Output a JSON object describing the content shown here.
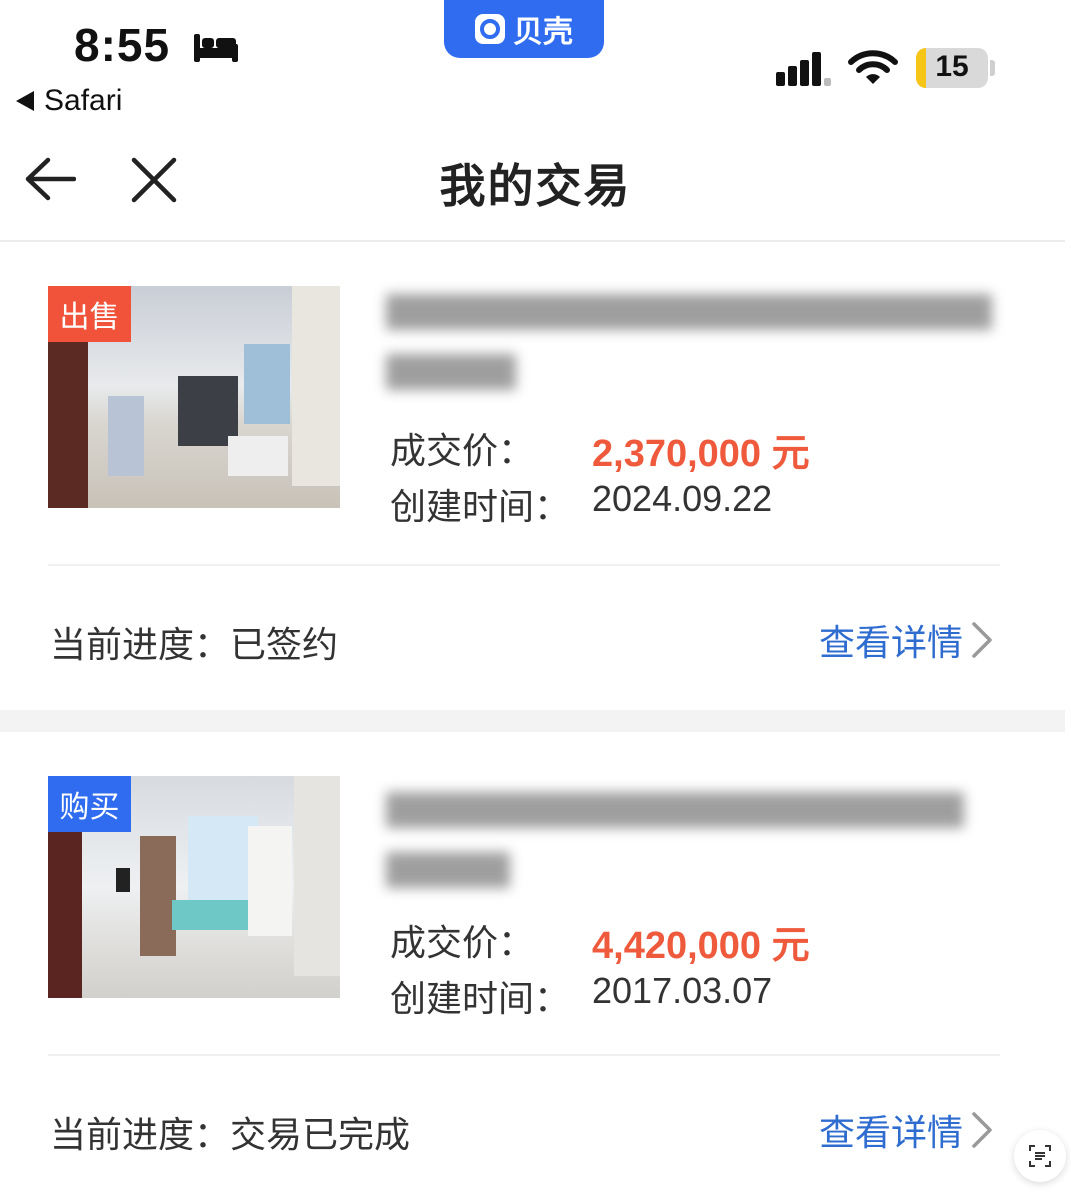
{
  "status_bar": {
    "time": "8:55",
    "back_app_label": "Safari",
    "app_name": "贝壳",
    "battery_level": "15"
  },
  "nav": {
    "title": "我的交易"
  },
  "transactions": [
    {
      "tag": "出售",
      "tag_color": "#f0533a",
      "price_label": "成交价：",
      "price": "2,370,000 元",
      "created_label": "创建时间：",
      "created": "2024.09.22",
      "progress_label": "当前进度：",
      "progress": "已签约",
      "details_label": "查看详情"
    },
    {
      "tag": "购买",
      "tag_color": "#2f6cf0",
      "price_label": "成交价：",
      "price": "4,420,000 元",
      "created_label": "创建时间：",
      "created": "2017.03.07",
      "progress_label": "当前进度：",
      "progress": "交易已完成",
      "details_label": "查看详情"
    }
  ],
  "colors": {
    "price": "#ef5a3c",
    "link": "#2f6cd0",
    "brand": "#2f6cf0"
  }
}
